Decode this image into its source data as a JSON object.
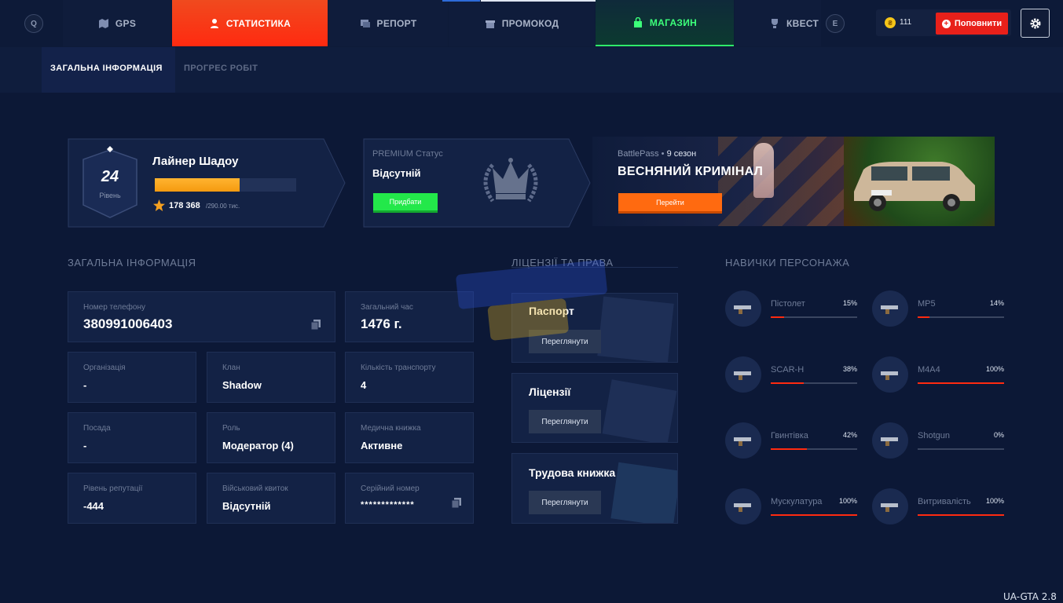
{
  "hotkeys": {
    "left": "Q",
    "right": "E"
  },
  "nav": {
    "gps": "GPS",
    "stats": "СТАТИСТИКА",
    "report": "РЕПОРТ",
    "promo": "ПРОМОКОД",
    "shop": "МАГАЗИН",
    "quests": "КВЕСТ"
  },
  "wallet": {
    "coins": "111",
    "topup": "Поповнити"
  },
  "subtabs": {
    "general": "ЗАГАЛЬНА ІНФОРМАЦІЯ",
    "progress": "ПРОГРЕС РОБІТ"
  },
  "player": {
    "level": "24",
    "level_label": "Рівень",
    "name": "Лайнер Шадоу",
    "xp_fraction": 0.6,
    "xp": "178 368",
    "xp_max": "/290.00 тис."
  },
  "premium": {
    "label": "PREMIUM Статус",
    "status": "Відсутній",
    "buy": "Придбати"
  },
  "battlepass": {
    "label": "BattlePass",
    "season": "9 сезон",
    "title": "ВЕСНЯНИЙ КРИМІНАЛ",
    "go": "Перейти"
  },
  "general": {
    "title": "ЗАГАЛЬНА ІНФОРМАЦІЯ",
    "phone_label": "Номер телефону",
    "phone": "380991006403",
    "time_label": "Загальний час",
    "time": "1476 г.",
    "org_label": "Організація",
    "org": "-",
    "clan_label": "Клан",
    "clan": "Shadow",
    "transport_label": "Кількість транспорту",
    "transport": "4",
    "position_label": "Посада",
    "position": "-",
    "role_label": "Роль",
    "role": "Модератор (4)",
    "med_label": "Медична книжка",
    "med": "Активне",
    "rep_label": "Рівень репутації",
    "rep": "-444",
    "military_label": "Військовий квиток",
    "military": "Відсутній",
    "serial_label": "Серійний номер",
    "serial": "*************"
  },
  "licenses": {
    "title": "ЛІЦЕНЗІЇ ТА ПРАВА",
    "passport": "Паспорт",
    "licenses": "Ліцензії",
    "workbook": "Трудова книжка",
    "view": "Переглянути"
  },
  "skills": {
    "title": "НАВИЧКИ ПЕРСОНАЖА",
    "items": [
      {
        "name": "Пістолет",
        "pct": "15%",
        "value": 15
      },
      {
        "name": "MP5",
        "pct": "14%",
        "value": 14
      },
      {
        "name": "SCAR-H",
        "pct": "38%",
        "value": 38
      },
      {
        "name": "M4A4",
        "pct": "100%",
        "value": 100
      },
      {
        "name": "Гвинтівка",
        "pct": "42%",
        "value": 42
      },
      {
        "name": "Shotgun",
        "pct": "0%",
        "value": 0
      },
      {
        "name": "Мускулатура",
        "pct": "100%",
        "value": 100
      },
      {
        "name": "Витривалість",
        "pct": "100%",
        "value": 100
      }
    ]
  },
  "footer": {
    "version": "UA-GTA 2.8"
  },
  "colors": {
    "accent": "#ff2a10",
    "green": "#23e84a",
    "orange": "#ff6a10",
    "bg": "#0c1836"
  }
}
